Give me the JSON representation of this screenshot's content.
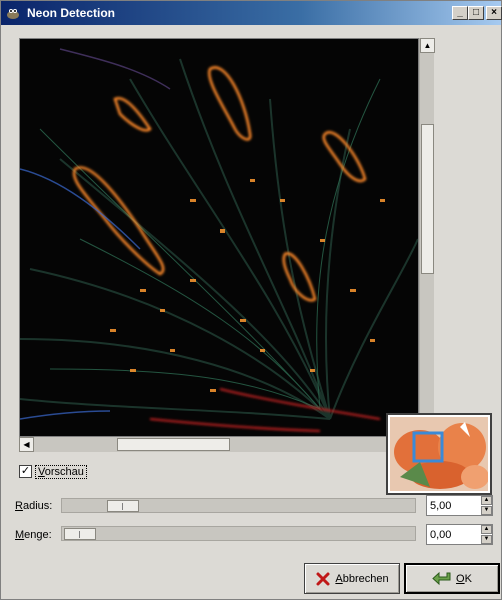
{
  "window": {
    "title": "Neon Detection",
    "controls": {
      "minimize": "_",
      "maximize": "□",
      "close": "×"
    }
  },
  "icons": {
    "app": "wilber-icon",
    "scroll_up": "arrow-up-icon",
    "scroll_left": "arrow-left-icon",
    "cancel": "red-x-icon",
    "ok": "green-arrow-icon"
  },
  "preview": {
    "checkbox_checked": true,
    "check_glyph": "✓",
    "label_first": "V",
    "label_rest": "orschau"
  },
  "params": {
    "radius": {
      "label_first": "R",
      "label_rest": "adius:",
      "value": "5,00",
      "level": 0.07
    },
    "amount": {
      "label_first": "M",
      "label_rest": "enge:",
      "value": "0,00",
      "level": 0.0
    }
  },
  "buttons": {
    "cancel_first": "A",
    "cancel_rest": "bbrechen",
    "ok_first": "O",
    "ok_rest": "K"
  },
  "colors": {
    "title_bar_start": "#0a246a",
    "title_bar_end": "#a6caf0",
    "neon_orange": "#ff8a2a",
    "neon_red": "#e02020",
    "neon_green": "#3dc060",
    "preview_bg": "#050505",
    "thumb_highlight": "#3a8ad8"
  }
}
